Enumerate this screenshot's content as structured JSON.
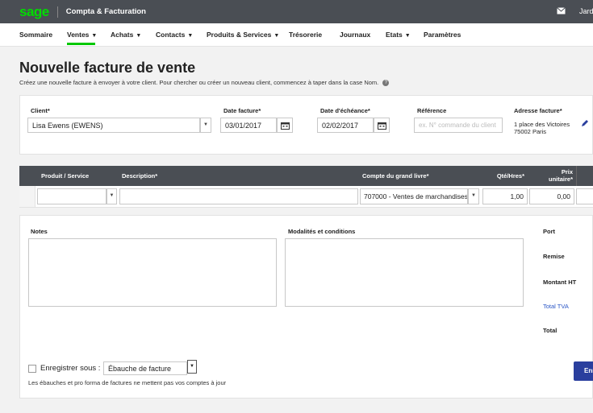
{
  "topbar": {
    "logo": "sage",
    "app_title": "Compta & Facturation",
    "user": "Jardi",
    "icon": "mail-icon"
  },
  "nav": [
    {
      "label": "Sommaire",
      "caret": ""
    },
    {
      "label": "Ventes",
      "caret": "▼"
    },
    {
      "label": "Achats",
      "caret": "▼"
    },
    {
      "label": "Contacts",
      "caret": "▼"
    },
    {
      "label": "Produits & Services",
      "caret": "▼"
    },
    {
      "label": "Trésorerie",
      "caret": ""
    },
    {
      "label": "Journaux",
      "caret": ""
    },
    {
      "label": "Etats",
      "caret": "▼"
    },
    {
      "label": "Paramètres",
      "caret": ""
    }
  ],
  "page": {
    "title": "Nouvelle facture de vente",
    "subtitle": "Créez une nouvelle facture à envoyer à votre client. Pour chercher ou créer un nouveau client, commencez à taper dans la case Nom."
  },
  "form": {
    "client_label": "Client*",
    "client_value": "Lisa Ewens (EWENS)",
    "date_label": "Date facture*",
    "date_value": "03/01/2017",
    "due_label": "Date d'échéance*",
    "due_value": "02/02/2017",
    "ref_label": "Référence",
    "ref_placeholder": "ex. N° commande du client",
    "address_label": "Adresse facture*",
    "address_line1": "1 place des Victoires",
    "address_line2": "75002 Paris"
  },
  "table": {
    "headers": {
      "product": "Produit / Service",
      "description": "Description*",
      "account": "Compte du grand livre*",
      "qty": "Qté/Hres*",
      "price_line1": "Prix",
      "price_line2": "unitaire*"
    },
    "row": {
      "product": "",
      "description": "",
      "account": "707000 - Ventes de marchandises",
      "qty": "1,00",
      "price": "0,00"
    }
  },
  "bottom": {
    "notes_label": "Notes",
    "terms_label": "Modalités et conditions",
    "totals": {
      "port": "Port",
      "remise": "Remise",
      "ht": "Montant HT",
      "tva": "Total TVA",
      "total": "Total"
    },
    "save_label": "Enregistrer sous :",
    "save_option": "Ébauche de facture",
    "note": "Les ébauches et pro forma de factures ne mettent pas vos comptes à jour",
    "primary_button": "Enr"
  },
  "colors": {
    "topbar": "#4a4e54",
    "brand": "#00dc00",
    "accent": "#2a3f9e",
    "link": "#2a56c6"
  }
}
